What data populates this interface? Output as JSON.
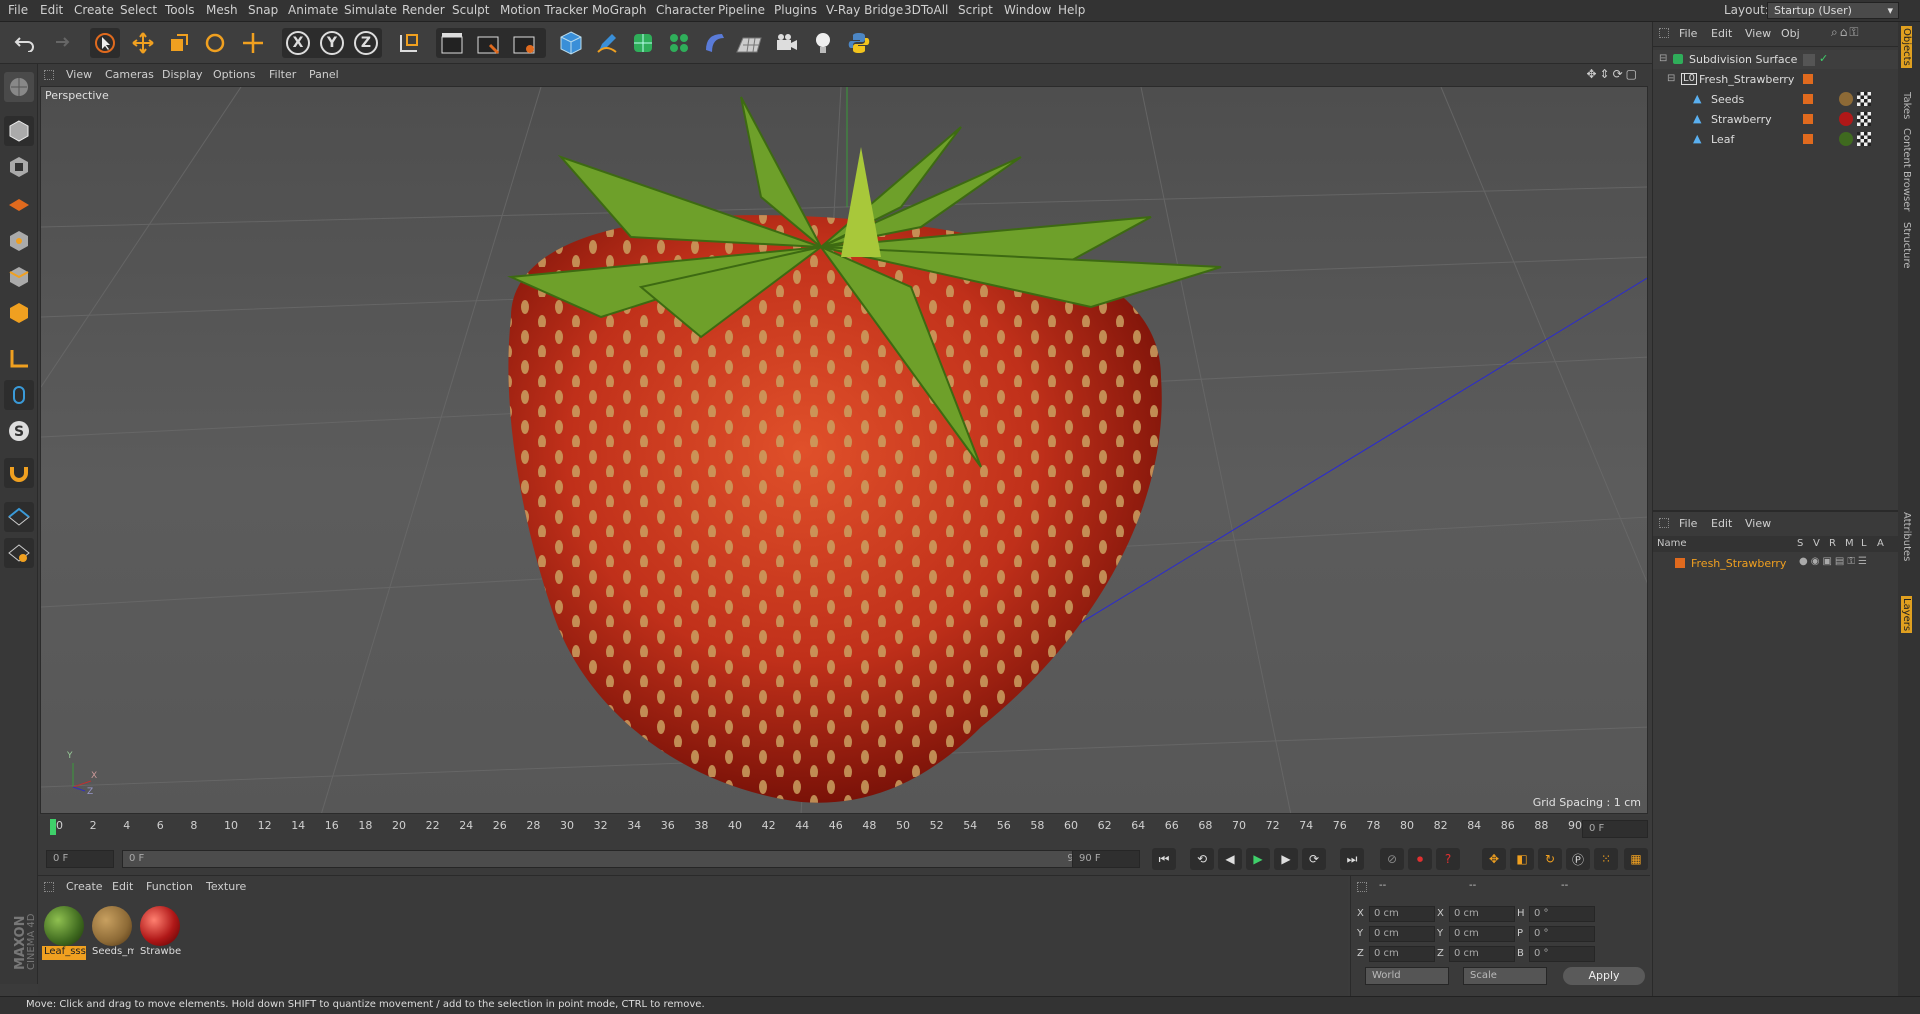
{
  "menubar": {
    "items": [
      "File",
      "Edit",
      "Create",
      "Select",
      "Tools",
      "Mesh",
      "Snap",
      "Animate",
      "Simulate",
      "Render",
      "Sculpt",
      "Motion Tracker",
      "MoGraph",
      "Character",
      "Pipeline",
      "Plugins",
      "V-Ray Bridge",
      "3DToAll",
      "Script",
      "Window",
      "Help"
    ],
    "layout_label": "Layout:",
    "layout_value": "Startup (User)"
  },
  "toolbar": {
    "icons": [
      "undo-icon",
      "redo-icon",
      "select-icon",
      "move-icon",
      "scale-icon",
      "rotate-icon",
      "axis-move-icon",
      "x-axis-icon",
      "y-axis-icon",
      "z-axis-icon",
      "coordinate-system-icon",
      "render-view-icon",
      "render-picture-viewer-icon",
      "render-settings-icon",
      "cube-icon",
      "pen-icon",
      "subdivision-icon",
      "cloner-icon",
      "deformer-icon",
      "floor-icon",
      "camera-icon",
      "light-icon",
      "python-icon"
    ],
    "x_label": "X",
    "y_label": "Y",
    "z_label": "Z"
  },
  "viewport_menu": [
    "View",
    "Cameras",
    "Display",
    "Options",
    "Filter",
    "Panel"
  ],
  "viewport": {
    "title": "Perspective",
    "grid_spacing": "Grid Spacing : 1 cm",
    "axis_x": "X",
    "axis_y": "Y",
    "axis_z": "Z"
  },
  "timeline": {
    "ticks": [
      "0",
      "2",
      "4",
      "6",
      "8",
      "10",
      "12",
      "14",
      "16",
      "18",
      "20",
      "22",
      "24",
      "26",
      "28",
      "30",
      "32",
      "34",
      "36",
      "38",
      "40",
      "42",
      "44",
      "46",
      "48",
      "50",
      "52",
      "54",
      "56",
      "58",
      "60",
      "62",
      "64",
      "66",
      "68",
      "70",
      "72",
      "74",
      "76",
      "78",
      "80",
      "82",
      "84",
      "86",
      "88",
      "90"
    ],
    "current_frame": "0 F"
  },
  "transport": {
    "start": "0 F",
    "range_start": "0 F",
    "range_end": "90 F",
    "end": "90 F"
  },
  "materials": {
    "menu": [
      "Create",
      "Edit",
      "Function",
      "Texture"
    ],
    "items": [
      {
        "name": "Leaf_sss",
        "color": "#3f6a1f"
      },
      {
        "name": "Seeds_m",
        "color": "#8d6a36"
      },
      {
        "name": "Strawbe",
        "color": "#b01818"
      }
    ]
  },
  "coords": {
    "header1": "--",
    "header2": "--",
    "header3": "--",
    "rows": [
      {
        "a": "X",
        "av": "0 cm",
        "b": "X",
        "bv": "0 cm",
        "c": "H",
        "cv": "0 °"
      },
      {
        "a": "Y",
        "av": "0 cm",
        "b": "Y",
        "bv": "0 cm",
        "c": "P",
        "cv": "0 °"
      },
      {
        "a": "Z",
        "av": "0 cm",
        "b": "Z",
        "bv": "0 cm",
        "c": "B",
        "cv": "0 °"
      }
    ],
    "world": "World",
    "scale": "Scale",
    "apply": "Apply"
  },
  "object_manager": {
    "menu": [
      "File",
      "Edit",
      "View",
      "Obj"
    ],
    "objects": [
      {
        "name": "Subdivision Surface",
        "indent": 0
      },
      {
        "name": "Fresh_Strawberry",
        "indent": 1
      },
      {
        "name": "Seeds",
        "indent": 2
      },
      {
        "name": "Strawberry",
        "indent": 2
      },
      {
        "name": "Leaf",
        "indent": 2
      }
    ]
  },
  "layer_manager": {
    "menu": [
      "File",
      "Edit",
      "View"
    ],
    "col_name": "Name",
    "cols": [
      "S",
      "V",
      "R",
      "M",
      "L",
      "A"
    ],
    "layers": [
      "Fresh_Strawberry"
    ]
  },
  "side_tabs": [
    "Objects",
    "Takes",
    "Content Browser",
    "Structure",
    "Attributes",
    "Layers"
  ],
  "status": "Move: Click and drag to move elements. Hold down SHIFT to quantize movement / add to the selection in point mode, CTRL to remove.",
  "brand": "MAXON CINEMA 4D",
  "colors": {
    "accent": "#e06a1e",
    "selected": "#f0a020"
  }
}
